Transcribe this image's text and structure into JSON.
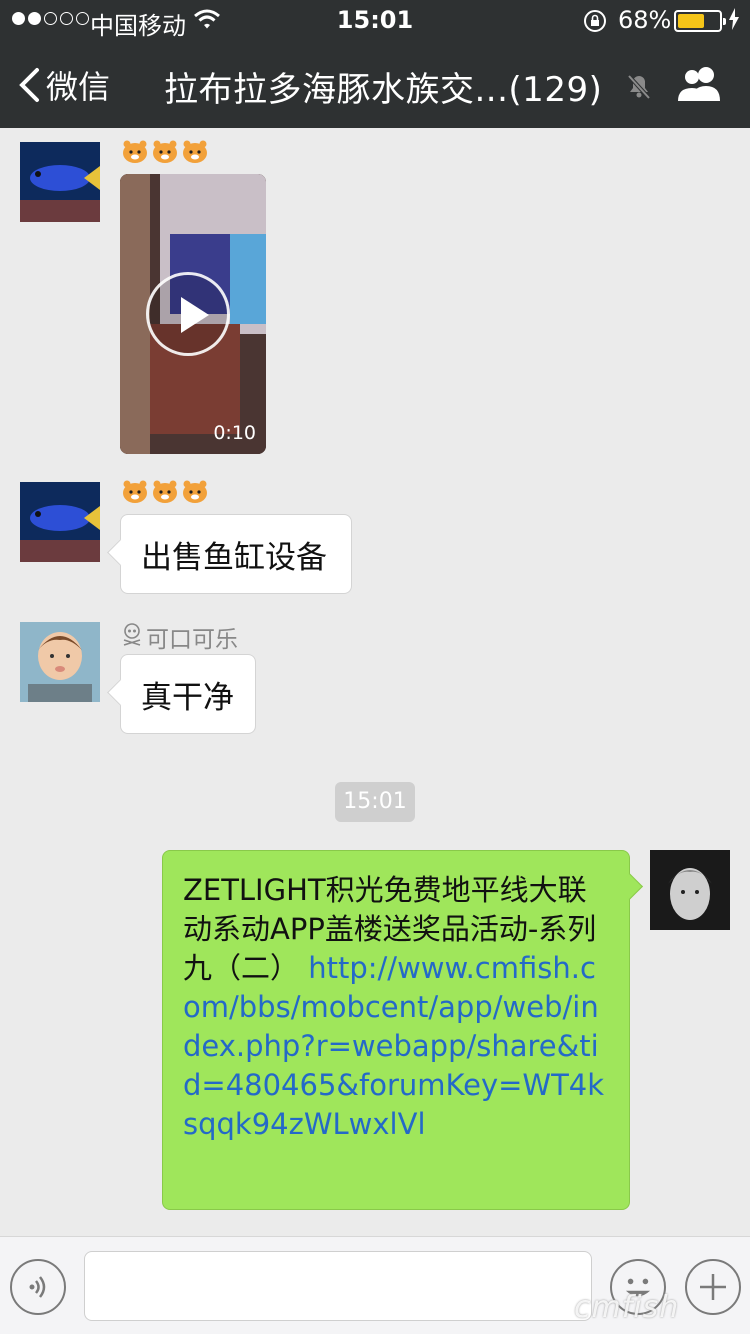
{
  "status": {
    "carrier": "中国移动",
    "time": "15:01",
    "battery": "68%",
    "battery_level": 0.68
  },
  "nav": {
    "back_label": "微信",
    "title": "拉布拉多海豚水族交...(129)"
  },
  "messages": [
    {
      "sender": "",
      "type": "video",
      "duration": "0:10"
    },
    {
      "sender": "",
      "type": "text",
      "text": "出售鱼缸设备"
    },
    {
      "sender": "可口可乐",
      "type": "text",
      "text": "真干净"
    }
  ],
  "time_divider": "15:01",
  "outgoing": {
    "text": "ZETLIGHT积光免费地平线大联动系动APP盖楼送奖品活动-系列九（二）",
    "url": "http://www.cmfish.com/bbs/mobcent/app/web/index.php?r=webapp/share&tid=480465&forumKey=WT4ksqqk94zWLwxlVl"
  },
  "watermark": "cmfish",
  "icons": [
    "signal-icon",
    "wifi-icon",
    "orientation-lock-icon",
    "battery-icon",
    "charging-icon",
    "back-chevron-icon",
    "mute-icon",
    "group-members-icon",
    "voice-icon",
    "emoji-icon",
    "plus-icon",
    "tiger-emoji-icon",
    "play-icon"
  ],
  "colors": {
    "nav_bg": "#2e3132",
    "chat_bg": "#ebebeb",
    "outgoing_bubble": "#9fe65b",
    "link": "#2469c8",
    "battery_fill": "#f5c518"
  }
}
